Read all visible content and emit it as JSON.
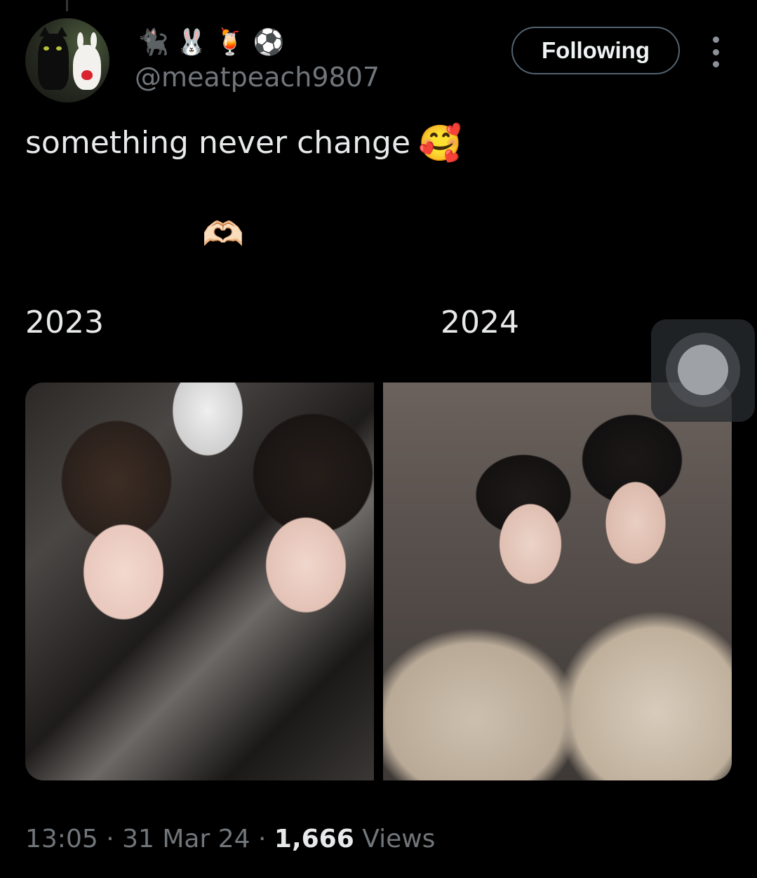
{
  "tweet": {
    "author": {
      "display_name_emojis": [
        "🐈‍⬛",
        "🐰",
        "🍹",
        "⚽"
      ],
      "handle": "@meatpeach9807"
    },
    "follow_label": "Following",
    "text": "something never change",
    "text_emoji": "🥰",
    "heart_hands_emoji": "🫶🏻",
    "images": [
      {
        "caption": "2023"
      },
      {
        "caption": "2024"
      }
    ],
    "meta": {
      "time": "13:05",
      "separator": "·",
      "date": "31 Mar 24",
      "views_count": "1,666",
      "views_label": "Views"
    }
  },
  "icons": {
    "more": "more-vertical-icon",
    "floating": "floating-assistive-touch-icon"
  },
  "colors": {
    "background": "#000000",
    "primary_text": "#e7e9ea",
    "secondary_text": "#71767b",
    "button_border": "#536471"
  }
}
